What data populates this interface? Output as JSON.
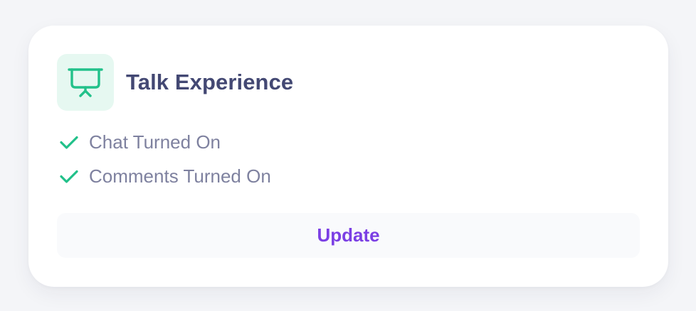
{
  "card": {
    "title": "Talk Experience",
    "icon": "presentation-screen-icon",
    "features": [
      {
        "label": "Chat Turned On",
        "icon": "check-icon"
      },
      {
        "label": "Comments Turned On",
        "icon": "check-icon"
      }
    ],
    "update_label": "Update"
  },
  "colors": {
    "accent_green": "#22c18a",
    "icon_tile_bg": "#e6f8f1",
    "title": "#434873",
    "feature_text": "#7e819f",
    "button_text": "#7b3fe4",
    "button_bg": "#f9fafc"
  }
}
